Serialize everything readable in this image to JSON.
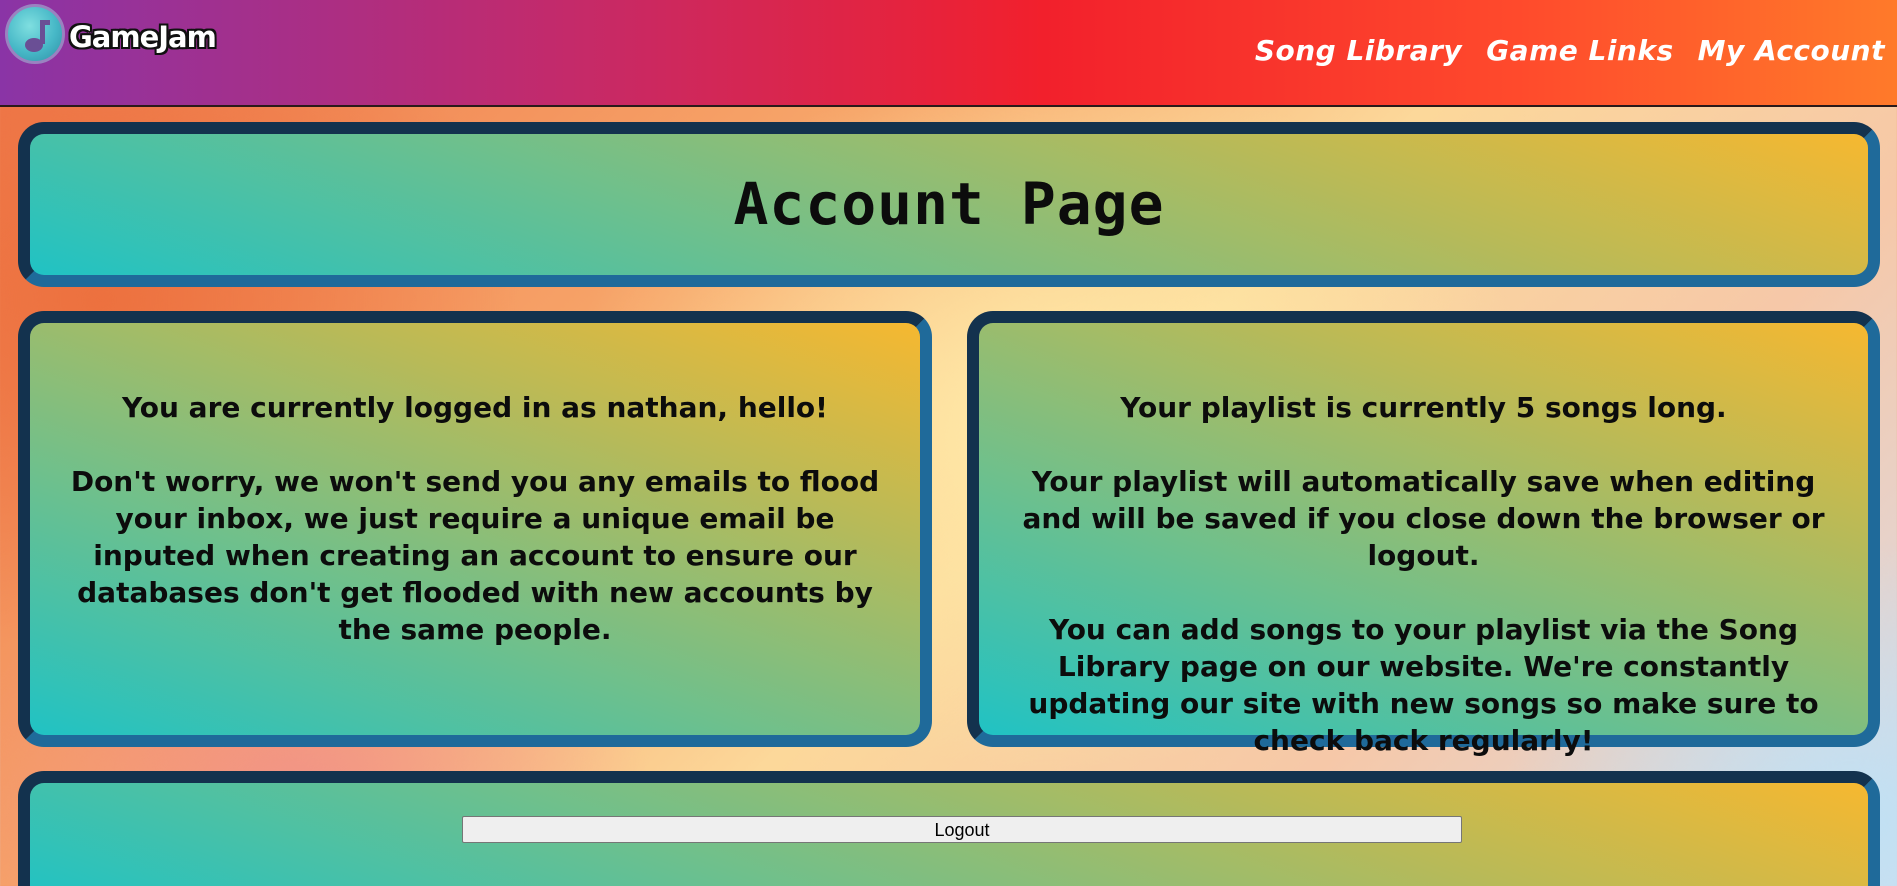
{
  "header": {
    "logo_text": "GameJam",
    "logo_icon": "music-note-icon",
    "nav": [
      {
        "label": "Song Library"
      },
      {
        "label": "Game Links"
      },
      {
        "label": "My Account"
      }
    ]
  },
  "title_panel": {
    "heading": "Account Page"
  },
  "left_panel": {
    "login_message": "You are currently logged in as nathan, hello!",
    "email_note": "Don't worry, we won't send you any emails to flood your inbox, we just require a unique email be inputed when creating an account to ensure our databases don't get flooded with new accounts by the same people."
  },
  "right_panel": {
    "playlist_length": "Your playlist is currently 5 songs long.",
    "autosave_note": "Your playlist will automatically save when editing and will be saved if you close down the browser or logout.",
    "library_note": "You can add songs to your playlist via the Song Library page on our website. We're constantly updating our site with new songs so make sure to check back regularly!"
  },
  "bottom_panel": {
    "logout_label": "Logout"
  },
  "colors": {
    "panel_border_dark": "#13324e",
    "panel_border_light": "#1f6a9a",
    "panel_gradient_start": "#20c2c4",
    "panel_gradient_end": "#f6b830"
  }
}
